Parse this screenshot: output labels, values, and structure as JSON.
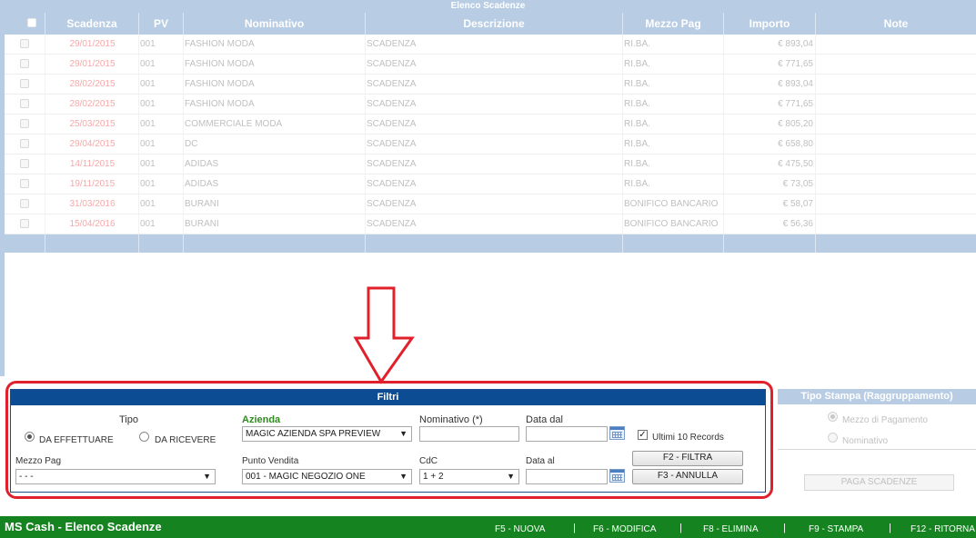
{
  "grid": {
    "title": "Elenco Scadenze",
    "columns": [
      "",
      "Scadenza",
      "PV",
      "Nominativo",
      "Descrizione",
      "Mezzo Pag",
      "Importo",
      "Note"
    ],
    "rows": [
      {
        "scadenza": "29/01/2015",
        "pv": "001",
        "nominativo": "FASHION MODA",
        "descrizione": "SCADENZA",
        "mezzo": "RI.BA.",
        "importo": "€ 893,04",
        "note": ""
      },
      {
        "scadenza": "29/01/2015",
        "pv": "001",
        "nominativo": "FASHION MODA",
        "descrizione": "SCADENZA",
        "mezzo": "RI.BA.",
        "importo": "€ 771,65",
        "note": ""
      },
      {
        "scadenza": "28/02/2015",
        "pv": "001",
        "nominativo": "FASHION MODA",
        "descrizione": "SCADENZA",
        "mezzo": "RI.BA.",
        "importo": "€ 893,04",
        "note": ""
      },
      {
        "scadenza": "28/02/2015",
        "pv": "001",
        "nominativo": "FASHION MODA",
        "descrizione": "SCADENZA",
        "mezzo": "RI.BA.",
        "importo": "€ 771,65",
        "note": ""
      },
      {
        "scadenza": "25/03/2015",
        "pv": "001",
        "nominativo": "COMMERCIALE MODA",
        "descrizione": "SCADENZA",
        "mezzo": "RI.BA.",
        "importo": "€ 805,20",
        "note": ""
      },
      {
        "scadenza": "29/04/2015",
        "pv": "001",
        "nominativo": "DC",
        "descrizione": "SCADENZA",
        "mezzo": "RI.BA.",
        "importo": "€ 658,80",
        "note": ""
      },
      {
        "scadenza": "14/11/2015",
        "pv": "001",
        "nominativo": "ADIDAS",
        "descrizione": "SCADENZA",
        "mezzo": "RI.BA.",
        "importo": "€ 475,50",
        "note": ""
      },
      {
        "scadenza": "19/11/2015",
        "pv": "001",
        "nominativo": "ADIDAS",
        "descrizione": "SCADENZA",
        "mezzo": "RI.BA.",
        "importo": "€ 73,05",
        "note": ""
      },
      {
        "scadenza": "31/03/2016",
        "pv": "001",
        "nominativo": "BURANI",
        "descrizione": "SCADENZA",
        "mezzo": "BONIFICO BANCARIO",
        "importo": "€ 58,07",
        "note": ""
      },
      {
        "scadenza": "15/04/2016",
        "pv": "001",
        "nominativo": "BURANI",
        "descrizione": "SCADENZA",
        "mezzo": "BONIFICO BANCARIO",
        "importo": "€ 56,36",
        "note": ""
      }
    ]
  },
  "filters": {
    "title": "Filtri",
    "tipo_label": "Tipo",
    "radio_effettuare": "DA EFFETTUARE",
    "radio_ricevere": "DA RICEVERE",
    "azienda_label": "Azienda",
    "azienda_value": "MAGIC AZIENDA SPA PREVIEW",
    "nominativo_label": "Nominativo (*)",
    "data_dal_label": "Data dal",
    "ultimi_label": "Ultimi 10 Records",
    "mezzo_pag_label": "Mezzo Pag",
    "mezzo_pag_value": "- - -",
    "punto_vendita_label": "Punto Vendita",
    "punto_vendita_value": "001 - MAGIC NEGOZIO ONE",
    "cdc_label": "CdC",
    "cdc_value": "1 + 2",
    "data_al_label": "Data al",
    "filtra_button": "F2 - FILTRA",
    "annulla_button": "F3 - ANNULLA"
  },
  "tipo_stampa": {
    "title": "Tipo Stampa (Raggruppamento)",
    "option_mezzo": "Mezzo di Pagamento",
    "option_nominativo": "Nominativo",
    "paga_button": "PAGA SCADENZE"
  },
  "bottom_bar": {
    "app_title": "MS Cash - Elenco Scadenze",
    "keys": [
      "F5 - NUOVA",
      "F6 - MODIFICA",
      "F8 - ELIMINA",
      "F9 - STAMPA",
      "F12 - RITORNA"
    ]
  },
  "colors": {
    "header_blue": "#b8cce4",
    "filters_blue": "#0b4c92",
    "highlight_red": "#e0202a",
    "bar_green": "#15831f"
  }
}
